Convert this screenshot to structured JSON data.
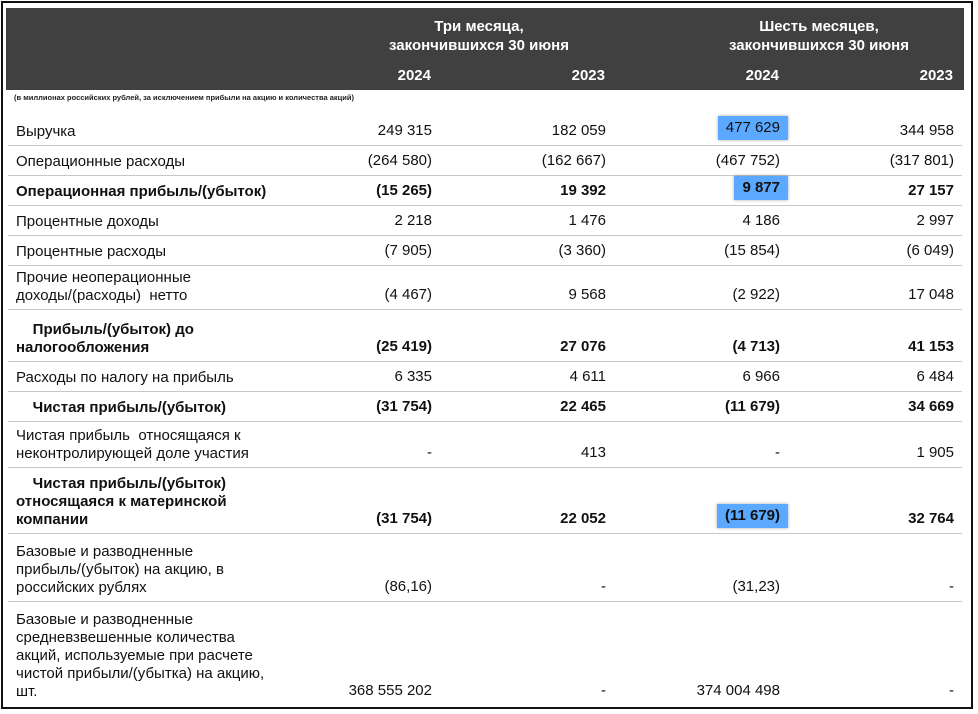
{
  "header": {
    "three_months": "Три месяца,\nзакончившихся 30 июня",
    "six_months": "Шесть месяцев,\nзакончившихся 30 июня",
    "years": [
      "2024",
      "2023",
      "2024",
      "2023"
    ]
  },
  "note": "(в миллионах российских рублей, за исключением прибыли на акцию и количества акций)",
  "rows": [
    {
      "label": "Выручка",
      "v": [
        "249 315",
        "182 059",
        "477 629",
        "344 958"
      ],
      "highlight": 2
    },
    {
      "label": "Операционные расходы",
      "v": [
        "(264 580)",
        "(162 667)",
        "(467 752)",
        "(317 801)"
      ]
    },
    {
      "label": "Операционная прибыль/(убыток)",
      "v": [
        "(15 265)",
        "19 392",
        "9 877",
        "27 157"
      ],
      "bold": true,
      "highlight": 2
    },
    {
      "label": "Процентные доходы",
      "v": [
        "2 218",
        "1 476",
        "4 186",
        "2 997"
      ]
    },
    {
      "label": "Процентные расходы",
      "v": [
        "(7 905)",
        "(3 360)",
        "(15 854)",
        "(6 049)"
      ]
    },
    {
      "label": "Прочие неоперационные\nдоходы/(расходы)  нетто",
      "v": [
        "(4 467)",
        "9 568",
        "(2 922)",
        "17 048"
      ]
    },
    {
      "label": "    Прибыль/(убыток) до\nналогообложения",
      "v": [
        "(25 419)",
        "27 076",
        "(4 713)",
        "41 153"
      ],
      "bold": true
    },
    {
      "label": "Расходы по налогу на прибыль",
      "v": [
        "6 335",
        "4 611",
        "6 966",
        "6 484"
      ]
    },
    {
      "label": "    Чистая прибыль/(убыток)",
      "v": [
        "(31 754)",
        "22 465",
        "(11 679)",
        "34 669"
      ],
      "bold": true
    },
    {
      "label": "Чистая прибыль  относящаяся к\nнеконтролирующей доле участия",
      "v": [
        "-",
        "413",
        "-",
        "1 905"
      ]
    },
    {
      "label": "    Чистая прибыль/(убыток)\nотносящаяся к материнской\nкомпании",
      "v": [
        "(31 754)",
        "22 052",
        "(11 679)",
        "32 764"
      ],
      "bold": true,
      "highlight": 2
    },
    {
      "label": "Базовые и разводненные\nприбыль/(убыток) на акцию, в\nроссийских рублях",
      "v": [
        "(86,16)",
        "-",
        "(31,23)",
        "-"
      ]
    },
    {
      "label": "Базовые и разводненные\nсредневзвешенные количества\nакций, используемые при расчете\nчистой прибыли/(убытка) на акцию,\nшт.",
      "v": [
        "368 555 202",
        "-",
        "374 004 498",
        "-"
      ]
    }
  ]
}
